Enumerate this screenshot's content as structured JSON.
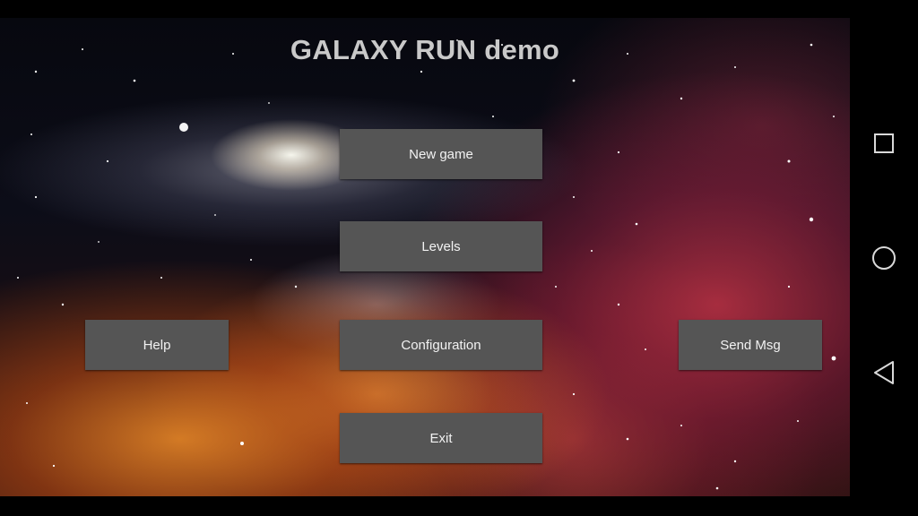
{
  "game": {
    "title": "GALAXY RUN demo"
  },
  "menu": {
    "new_game": "New game",
    "levels": "Levels",
    "configuration": "Configuration",
    "exit": "Exit",
    "help": "Help",
    "send_msg": "Send Msg"
  },
  "navigation": {
    "recents_icon": "square-icon",
    "home_icon": "circle-icon",
    "back_icon": "triangle-back-icon"
  },
  "colors": {
    "button_bg": "#555555",
    "button_text": "#f2f2f2",
    "title_text": "#c9c9c9",
    "nav_icon": "#d9d9d9"
  }
}
